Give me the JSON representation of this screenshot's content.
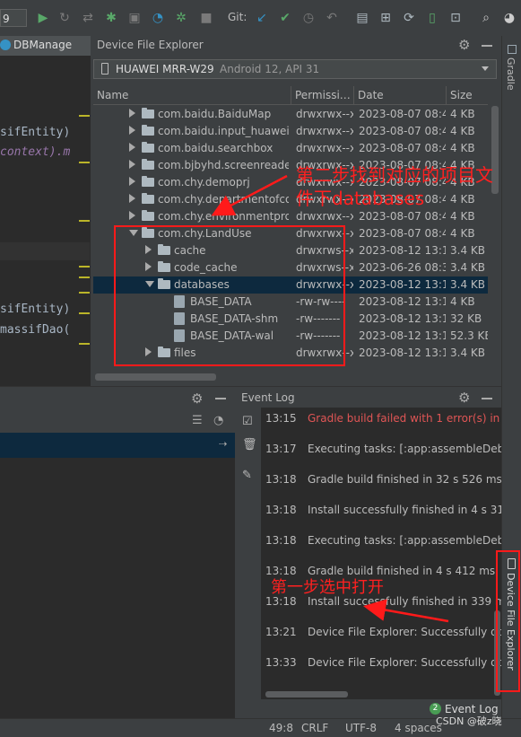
{
  "toolbar": {
    "config_combo": "9",
    "git_label": "Git:"
  },
  "editor": {
    "tab_label": "DBManage",
    "code_lines": [
      "sifEntity)",
      "context).m",
      "sifEntity)",
      "massifDao("
    ]
  },
  "device_file_explorer": {
    "title": "Device File Explorer",
    "device_name": "HUAWEI MRR-W29",
    "device_detail": "Android 12, API 31",
    "columns": [
      "Name",
      "Permissi…",
      "Date",
      "Size"
    ],
    "rows": [
      {
        "name": "com.baidu.BaiduMap",
        "perm": "drwxrwx--x",
        "date": "2023-08-07 08:49",
        "size": "4 KB",
        "indent": 0,
        "expanded": false,
        "type": "folder"
      },
      {
        "name": "com.baidu.input_huawei",
        "perm": "drwxrwx--x",
        "date": "2023-08-07 08:49",
        "size": "4 KB",
        "indent": 0,
        "expanded": false,
        "type": "folder"
      },
      {
        "name": "com.baidu.searchbox",
        "perm": "drwxrwx--x",
        "date": "2023-08-07 08:49",
        "size": "4 KB",
        "indent": 0,
        "expanded": false,
        "type": "folder"
      },
      {
        "name": "com.bjbyhd.screenreader",
        "perm": "drwxrwx--x",
        "date": "2023-08-07 08:49",
        "size": "4 KB",
        "indent": 0,
        "expanded": false,
        "type": "folder"
      },
      {
        "name": "com.chy.demoprj",
        "perm": "drwxrwx--x",
        "date": "2023-08-07 08:49",
        "size": "4 KB",
        "indent": 0,
        "expanded": false,
        "type": "folder"
      },
      {
        "name": "com.chy.departmentofcor",
        "perm": "drwxrwx--x",
        "date": "2023-08-07 08:49",
        "size": "4 KB",
        "indent": 0,
        "expanded": false,
        "type": "folder"
      },
      {
        "name": "com.chy.environmentprot",
        "perm": "drwxrwx--x",
        "date": "2023-08-07 08:49",
        "size": "4 KB",
        "indent": 0,
        "expanded": false,
        "type": "folder"
      },
      {
        "name": "com.chy.LandUse",
        "perm": "drwxrwx--x",
        "date": "2023-08-07 08:49",
        "size": "4 KB",
        "indent": 0,
        "expanded": true,
        "type": "folder"
      },
      {
        "name": "cache",
        "perm": "drwxrws--x",
        "date": "2023-08-12 13:18",
        "size": "3.4 KB",
        "indent": 1,
        "expanded": false,
        "type": "folder"
      },
      {
        "name": "code_cache",
        "perm": "drwxrws--x",
        "date": "2023-06-26 08:33",
        "size": "3.4 KB",
        "indent": 1,
        "expanded": false,
        "type": "folder"
      },
      {
        "name": "databases",
        "perm": "drwxrwx--x",
        "date": "2023-08-12 13:18",
        "size": "3.4 KB",
        "indent": 1,
        "expanded": true,
        "type": "folder",
        "selected": true
      },
      {
        "name": "BASE_DATA",
        "perm": "-rw-rw----",
        "date": "2023-08-12 13:18",
        "size": "4 KB",
        "indent": 2,
        "expanded": false,
        "type": "file"
      },
      {
        "name": "BASE_DATA-shm",
        "perm": "-rw-------",
        "date": "2023-08-12 13:18",
        "size": "32 KB",
        "indent": 2,
        "expanded": false,
        "type": "file"
      },
      {
        "name": "BASE_DATA-wal",
        "perm": "-rw-------",
        "date": "2023-08-12 13:18",
        "size": "52.3 KB",
        "indent": 2,
        "expanded": false,
        "type": "file"
      },
      {
        "name": "files",
        "perm": "drwxrwx--x",
        "date": "2023-08-12 13:19",
        "size": "3.4 KB",
        "indent": 1,
        "expanded": false,
        "type": "folder"
      }
    ]
  },
  "right_strip": {
    "gradle_label": "Gradle",
    "dfe_label": "Device File Explorer"
  },
  "event_log": {
    "title": "Event Log",
    "entries": [
      {
        "time": "13:15",
        "message": "Gradle build failed with 1 error(s) in 1",
        "error": true
      },
      {
        "time": "13:17",
        "message": "Executing tasks: [:app:assembleDebu",
        "error": false
      },
      {
        "time": "13:18",
        "message": "Gradle build finished in 32 s 526 ms",
        "error": false
      },
      {
        "time": "13:18",
        "message": "Install successfully finished in 4 s 314",
        "error": false
      },
      {
        "time": "13:18",
        "message": "Executing tasks: [:app:assembleDebu",
        "error": false
      },
      {
        "time": "13:18",
        "message": "Gradle build finished in 4 s 412 ms",
        "error": false
      },
      {
        "time": "13:18",
        "message": "Install successfully finished in 339 ms.",
        "error": false
      },
      {
        "time": "13:21",
        "message": "Device File Explorer: Successfully dow",
        "error": false
      },
      {
        "time": "13:33",
        "message": "Device File Explorer: Successfully dow",
        "error": false
      }
    ]
  },
  "status_bar": {
    "event_badge": "2",
    "event_label": "Event Log",
    "position": "49:8",
    "line_sep": "CRLF",
    "encoding": "UTF-8",
    "indent": "4 spaces",
    "watermark": "CSDN @破z晓"
  },
  "annotations": {
    "step2": "第二步找到对应的项目文件下databases",
    "step1": "第一步选中打开",
    "color": "#ff1a1a"
  }
}
